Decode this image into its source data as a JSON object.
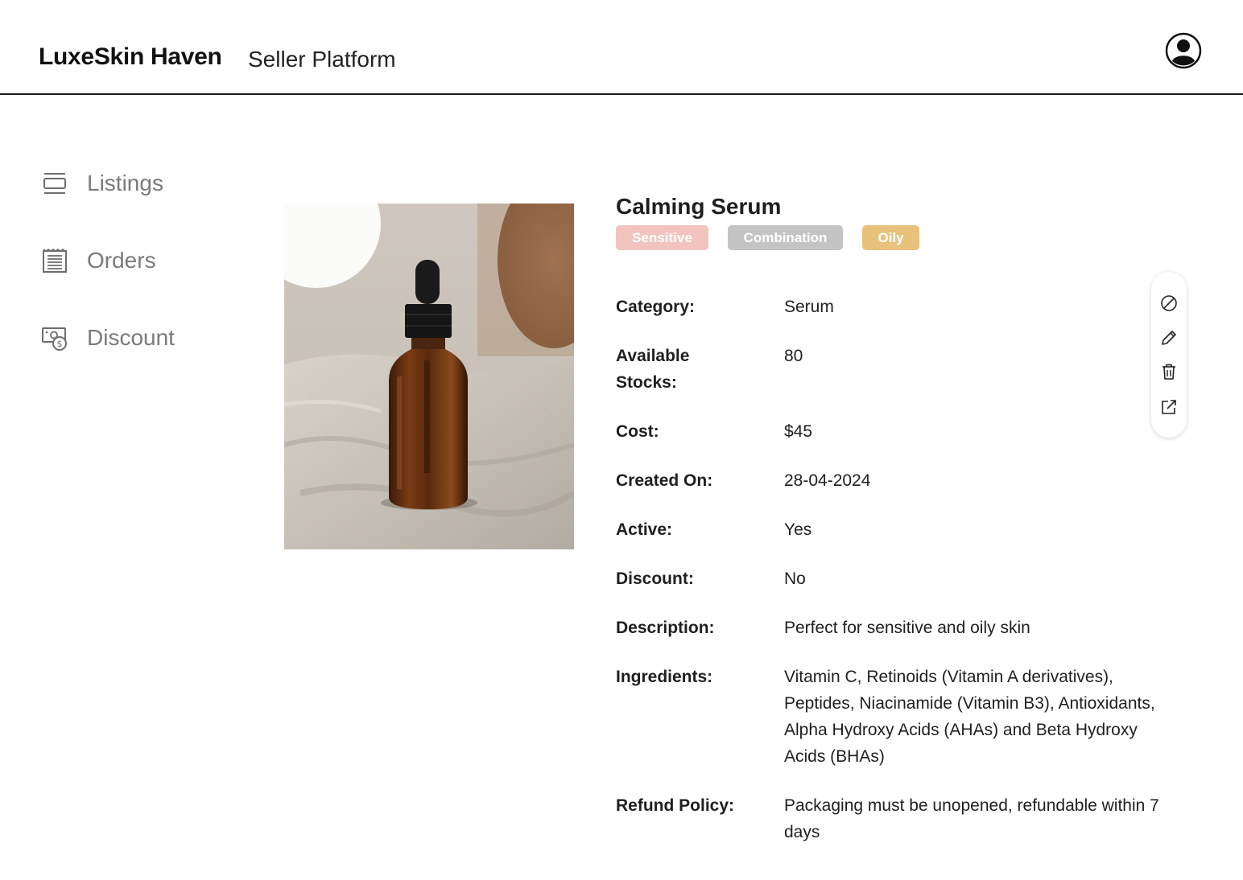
{
  "header": {
    "brand": "LuxeSkin Haven",
    "subtitle": "Seller Platform",
    "avatar_icon": "user-circle-icon"
  },
  "sidebar": {
    "items": [
      {
        "label": "Listings",
        "icon": "listings-icon"
      },
      {
        "label": "Orders",
        "icon": "receipt-icon"
      },
      {
        "label": "Discount",
        "icon": "discount-money-icon"
      }
    ]
  },
  "product": {
    "title": "Calming Serum",
    "image_icon": "amber-dropper-bottle-photo",
    "tags": [
      {
        "label": "Sensitive",
        "color": "#f2c4bf"
      },
      {
        "label": "Combination",
        "color": "#c4c4c4"
      },
      {
        "label": "Oily",
        "color": "#e8c27a"
      }
    ],
    "details": [
      {
        "label": "Category:",
        "value": "Serum"
      },
      {
        "label": "Available Stocks:",
        "value": "80"
      },
      {
        "label": "Cost:",
        "value": "$45"
      },
      {
        "label": "Created On:",
        "value": "28-04-2024"
      },
      {
        "label": "Active:",
        "value": "Yes"
      },
      {
        "label": "Discount:",
        "value": "No"
      },
      {
        "label": "Description:",
        "value": "Perfect for sensitive and oily skin"
      },
      {
        "label": "Ingredients:",
        "value": "Vitamin C, Retinoids (Vitamin A derivatives), Peptides, Niacinamide (Vitamin B3), Antioxidants, Alpha Hydroxy Acids (AHAs) and Beta Hydroxy Acids (BHAs)"
      },
      {
        "label": "Refund Policy:",
        "value": "Packaging must be unopened, refundable within 7 days"
      }
    ]
  },
  "actions": [
    {
      "icon": "deactivate-icon"
    },
    {
      "icon": "edit-pencil-icon"
    },
    {
      "icon": "delete-trash-icon"
    },
    {
      "icon": "open-external-icon"
    }
  ]
}
